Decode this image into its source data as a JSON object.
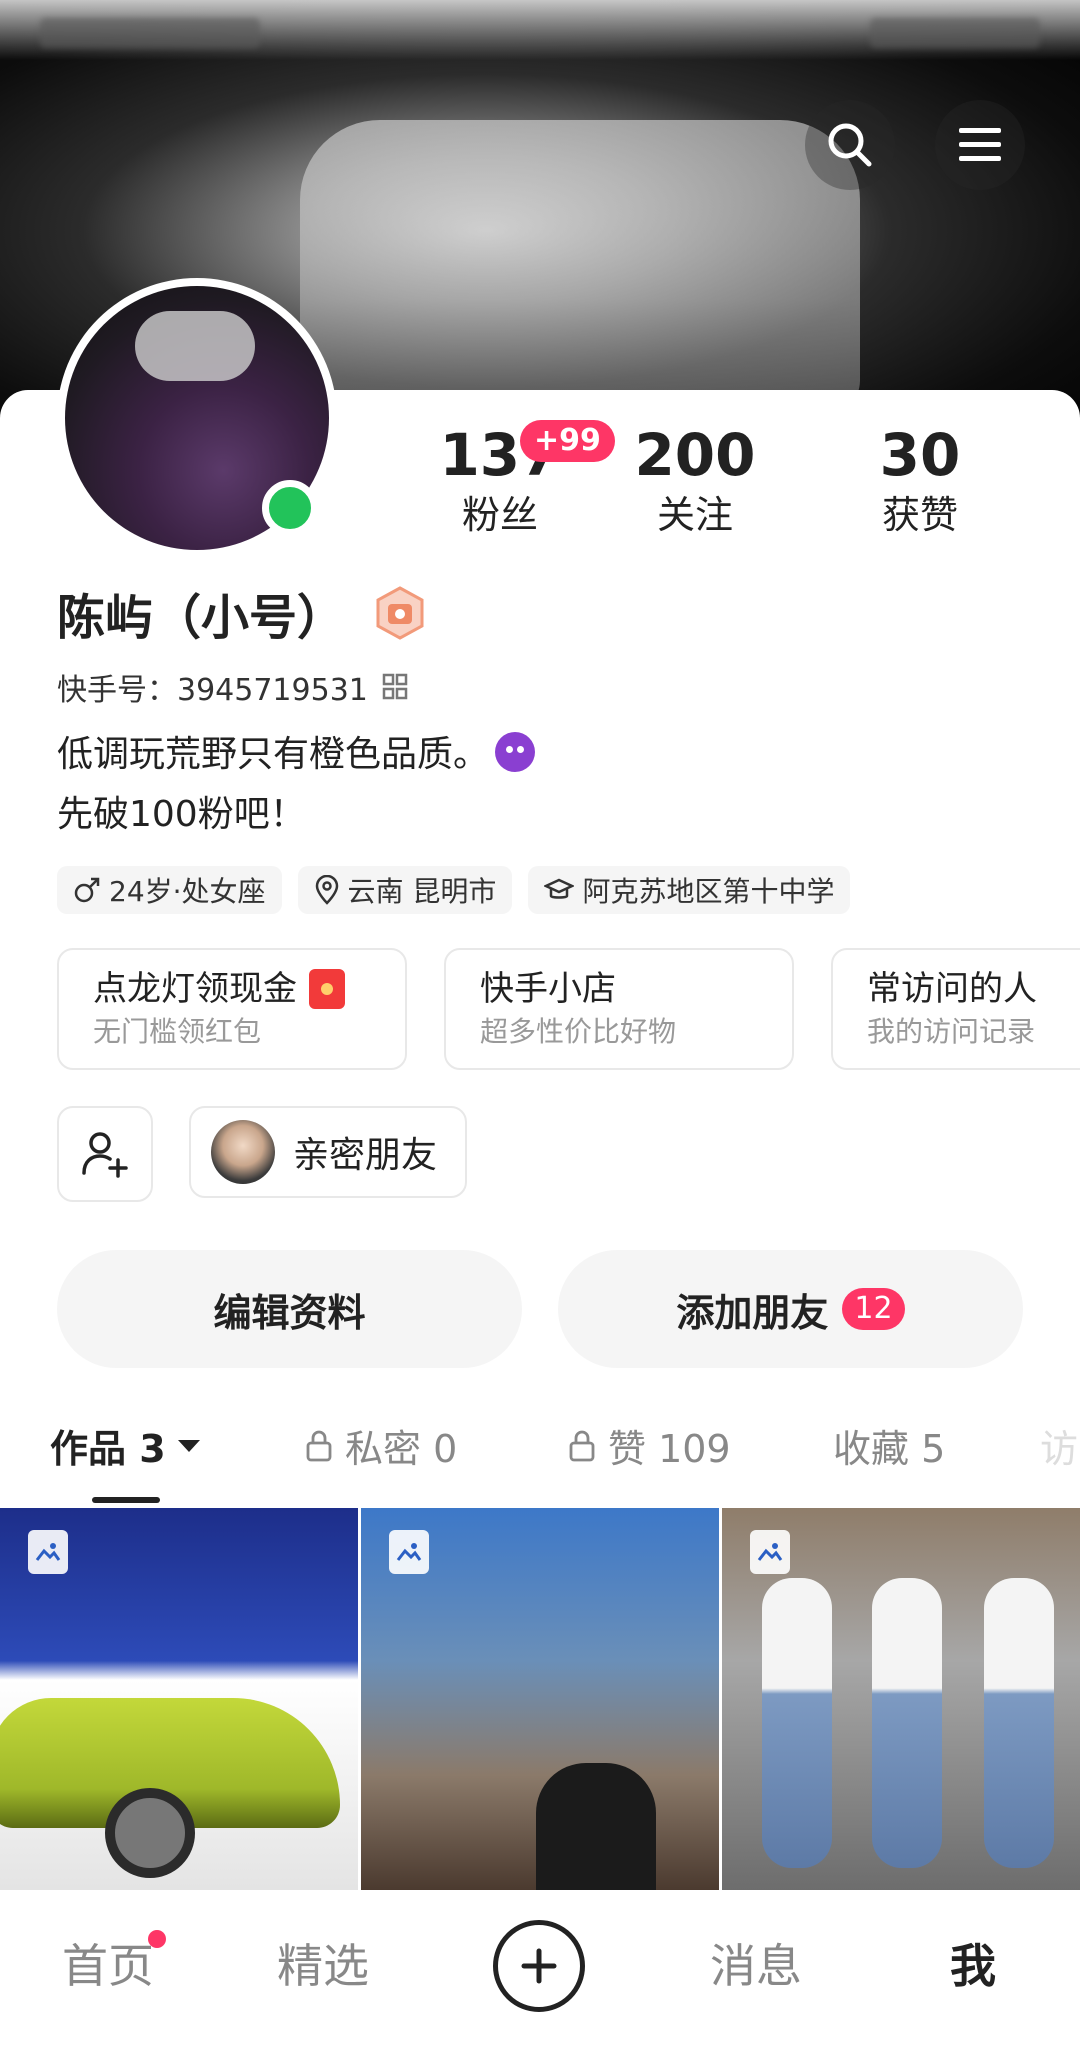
{
  "header": {
    "search_icon": "search-icon",
    "menu_icon": "menu-icon"
  },
  "profile": {
    "name": "陈屿（小号）",
    "kuaishou_id_label": "快手号：3945719531",
    "bio_line1": "低调玩荒野只有橙色品质。",
    "bio_line2": "先破100粉吧！",
    "online": true
  },
  "stats": [
    {
      "value": "137",
      "label": "粉丝",
      "badge": "+99"
    },
    {
      "value": "200",
      "label": "关注"
    },
    {
      "value": "30",
      "label": "获赞"
    }
  ],
  "tags": [
    {
      "icon": "male-icon",
      "text": "24岁·处女座"
    },
    {
      "icon": "location-icon",
      "text": "云南 昆明市"
    },
    {
      "icon": "school-icon",
      "text": "阿克苏地区第十中学"
    }
  ],
  "feature_cards": [
    {
      "title": "点龙灯领现金",
      "subtitle": "无门槛领红包",
      "icon": "red-packet-icon"
    },
    {
      "title": "快手小店",
      "subtitle": "超多性价比好物"
    },
    {
      "title": "常访问的人",
      "subtitle": "我的访问记录"
    }
  ],
  "friends": {
    "close_friends_label": "亲密朋友"
  },
  "actions": {
    "edit_profile": "编辑资料",
    "add_friends": "添加朋友",
    "add_friends_count": "12"
  },
  "tabs": [
    {
      "label": "作品 3",
      "active": true
    },
    {
      "label": "私密 0",
      "locked": true
    },
    {
      "label": "赞 109",
      "locked": true
    },
    {
      "label": "收藏 5"
    },
    {
      "label": "访"
    }
  ],
  "bottom_nav": [
    {
      "label": "首页",
      "dot": true
    },
    {
      "label": "精选"
    },
    {
      "label": "+"
    },
    {
      "label": "消息"
    },
    {
      "label": "我",
      "active": true
    }
  ],
  "colors": {
    "accent": "#fe3666",
    "online": "#22c35a"
  }
}
